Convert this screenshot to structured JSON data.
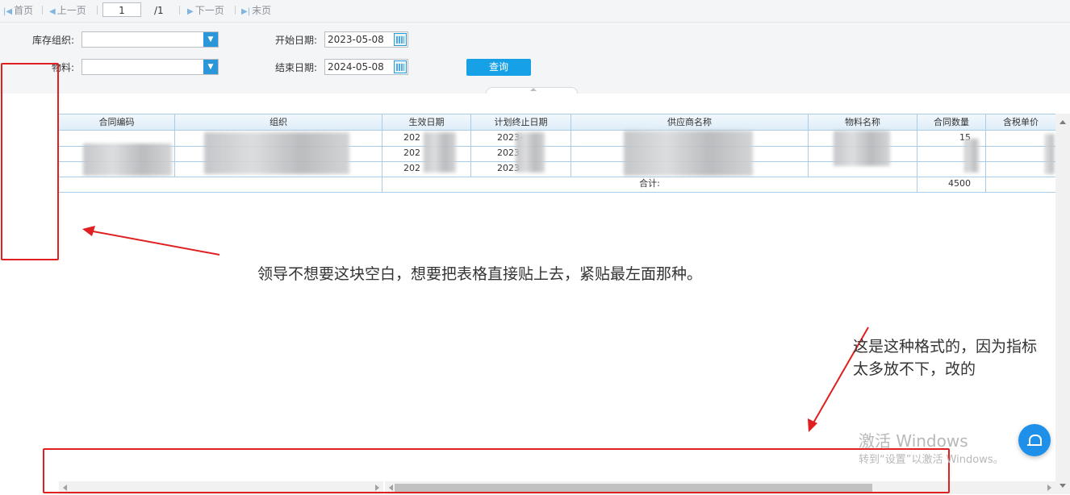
{
  "pager": {
    "first": "首页",
    "prev": "上一页",
    "page": "1",
    "total": "/1",
    "next": "下一页",
    "last": "末页"
  },
  "filters": {
    "org_label": "库存组织:",
    "material_label": "物料:",
    "start_label": "开始日期:",
    "start_value": "2023-05-08",
    "end_label": "结束日期:",
    "end_value": "2024-05-08",
    "query": "查询"
  },
  "grid": {
    "columns": [
      "合同编码",
      "组织",
      "生效日期",
      "计划终止日期",
      "供应商名称",
      "物料名称",
      "合同数量",
      "含税单价"
    ],
    "rows": [
      [
        "",
        "",
        "202",
        "2023-",
        "",
        "",
        "15",
        ""
      ],
      [
        "",
        "",
        "202",
        "2023",
        "",
        "",
        "",
        ""
      ],
      [
        "",
        "",
        "202",
        "2023",
        "",
        "",
        "",
        ""
      ]
    ],
    "footer_label": "合计:",
    "footer_qty": "4500"
  },
  "annotations": {
    "note1": "领导不想要这块空白，想要把表格直接贴上去，紧贴最左面那种。",
    "note2_line1": "这是这种格式的，因为指标",
    "note2_line2": "太多放不下，改的"
  },
  "watermark": {
    "line1": "激活 Windows",
    "line2": "转到“设置”以激活 Windows。"
  },
  "colors": {
    "accent": "#2b96d8",
    "annotation_red": "#e02020",
    "grid_border": "#a9cde8"
  }
}
